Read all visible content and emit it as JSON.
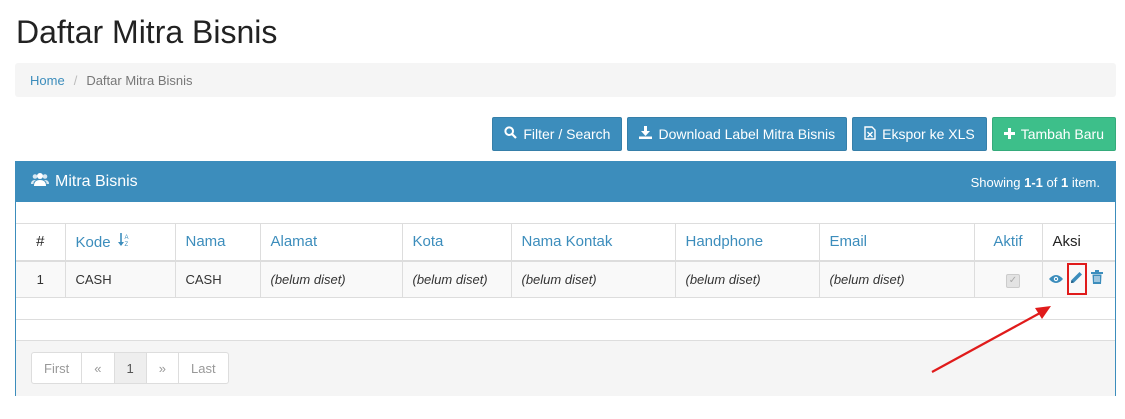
{
  "page": {
    "title": "Daftar Mitra Bisnis"
  },
  "breadcrumb": {
    "home": "Home",
    "separator": "/",
    "current": "Daftar Mitra Bisnis"
  },
  "toolbar": {
    "filter": "Filter / Search",
    "download": "Download Label Mitra Bisnis",
    "export": "Ekspor ke XLS",
    "add": "Tambah Baru"
  },
  "panel": {
    "title": "Mitra Bisnis",
    "summary_prefix": "Showing ",
    "summary_range": "1-1",
    "summary_of": " of ",
    "summary_total": "1",
    "summary_suffix": " item."
  },
  "table": {
    "headers": {
      "no": "#",
      "kode": "Kode",
      "nama": "Nama",
      "alamat": "Alamat",
      "kota": "Kota",
      "nama_kontak": "Nama Kontak",
      "handphone": "Handphone",
      "email": "Email",
      "aktif": "Aktif",
      "aksi": "Aksi"
    },
    "rows": [
      {
        "no": "1",
        "kode": "CASH",
        "nama": "CASH",
        "alamat": "(belum diset)",
        "kota": "(belum diset)",
        "nama_kontak": "(belum diset)",
        "handphone": "(belum diset)",
        "email": "(belum diset)",
        "aktif": true
      }
    ]
  },
  "pagination": {
    "first": "First",
    "prev": "«",
    "page": "1",
    "next": "»",
    "last": "Last"
  },
  "colors": {
    "primary": "#3c8dbc",
    "success": "#3dbf8a",
    "unset_text": "#a94442",
    "highlight": "#e01b1b"
  },
  "icons": {
    "filter": "search-icon",
    "download": "download-icon",
    "export": "file-excel-icon",
    "add": "plus-icon",
    "panel": "users-icon",
    "sort": "sort-alpha-icon",
    "view": "eye-icon",
    "edit": "pencil-icon",
    "delete": "trash-icon"
  }
}
